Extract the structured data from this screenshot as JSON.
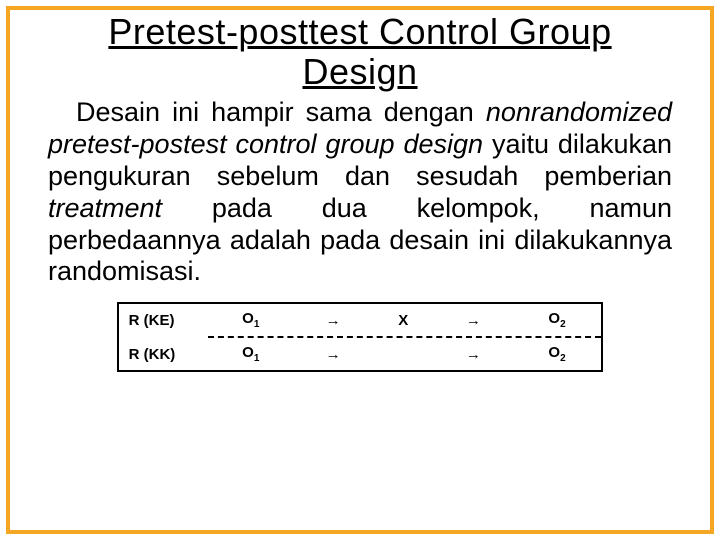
{
  "title": "Pretest-posttest Control Group Design",
  "para_plain_1": "Desain ini hampir sama dengan ",
  "para_ital_1": "nonrandomized pretest-postest control group design",
  "para_plain_2": " yaitu dilakukan pengukuran sebelum dan sesudah pemberian ",
  "para_ital_2": "treatment",
  "para_plain_3": " pada dua kelompok, namun perbedaannya adalah pada desain ini dilakukannya randomisasi.",
  "table": {
    "row1": {
      "label": "R (KE)",
      "o1": "O",
      "o1_sub": "1",
      "arr1": "→",
      "x": "X",
      "arr2": "→",
      "o2": "O",
      "o2_sub": "2"
    },
    "row2": {
      "label": "R (KK)",
      "o1": "O",
      "o1_sub": "1",
      "arr1": "→",
      "x": "",
      "arr2": "→",
      "o2": "O",
      "o2_sub": "2"
    }
  }
}
